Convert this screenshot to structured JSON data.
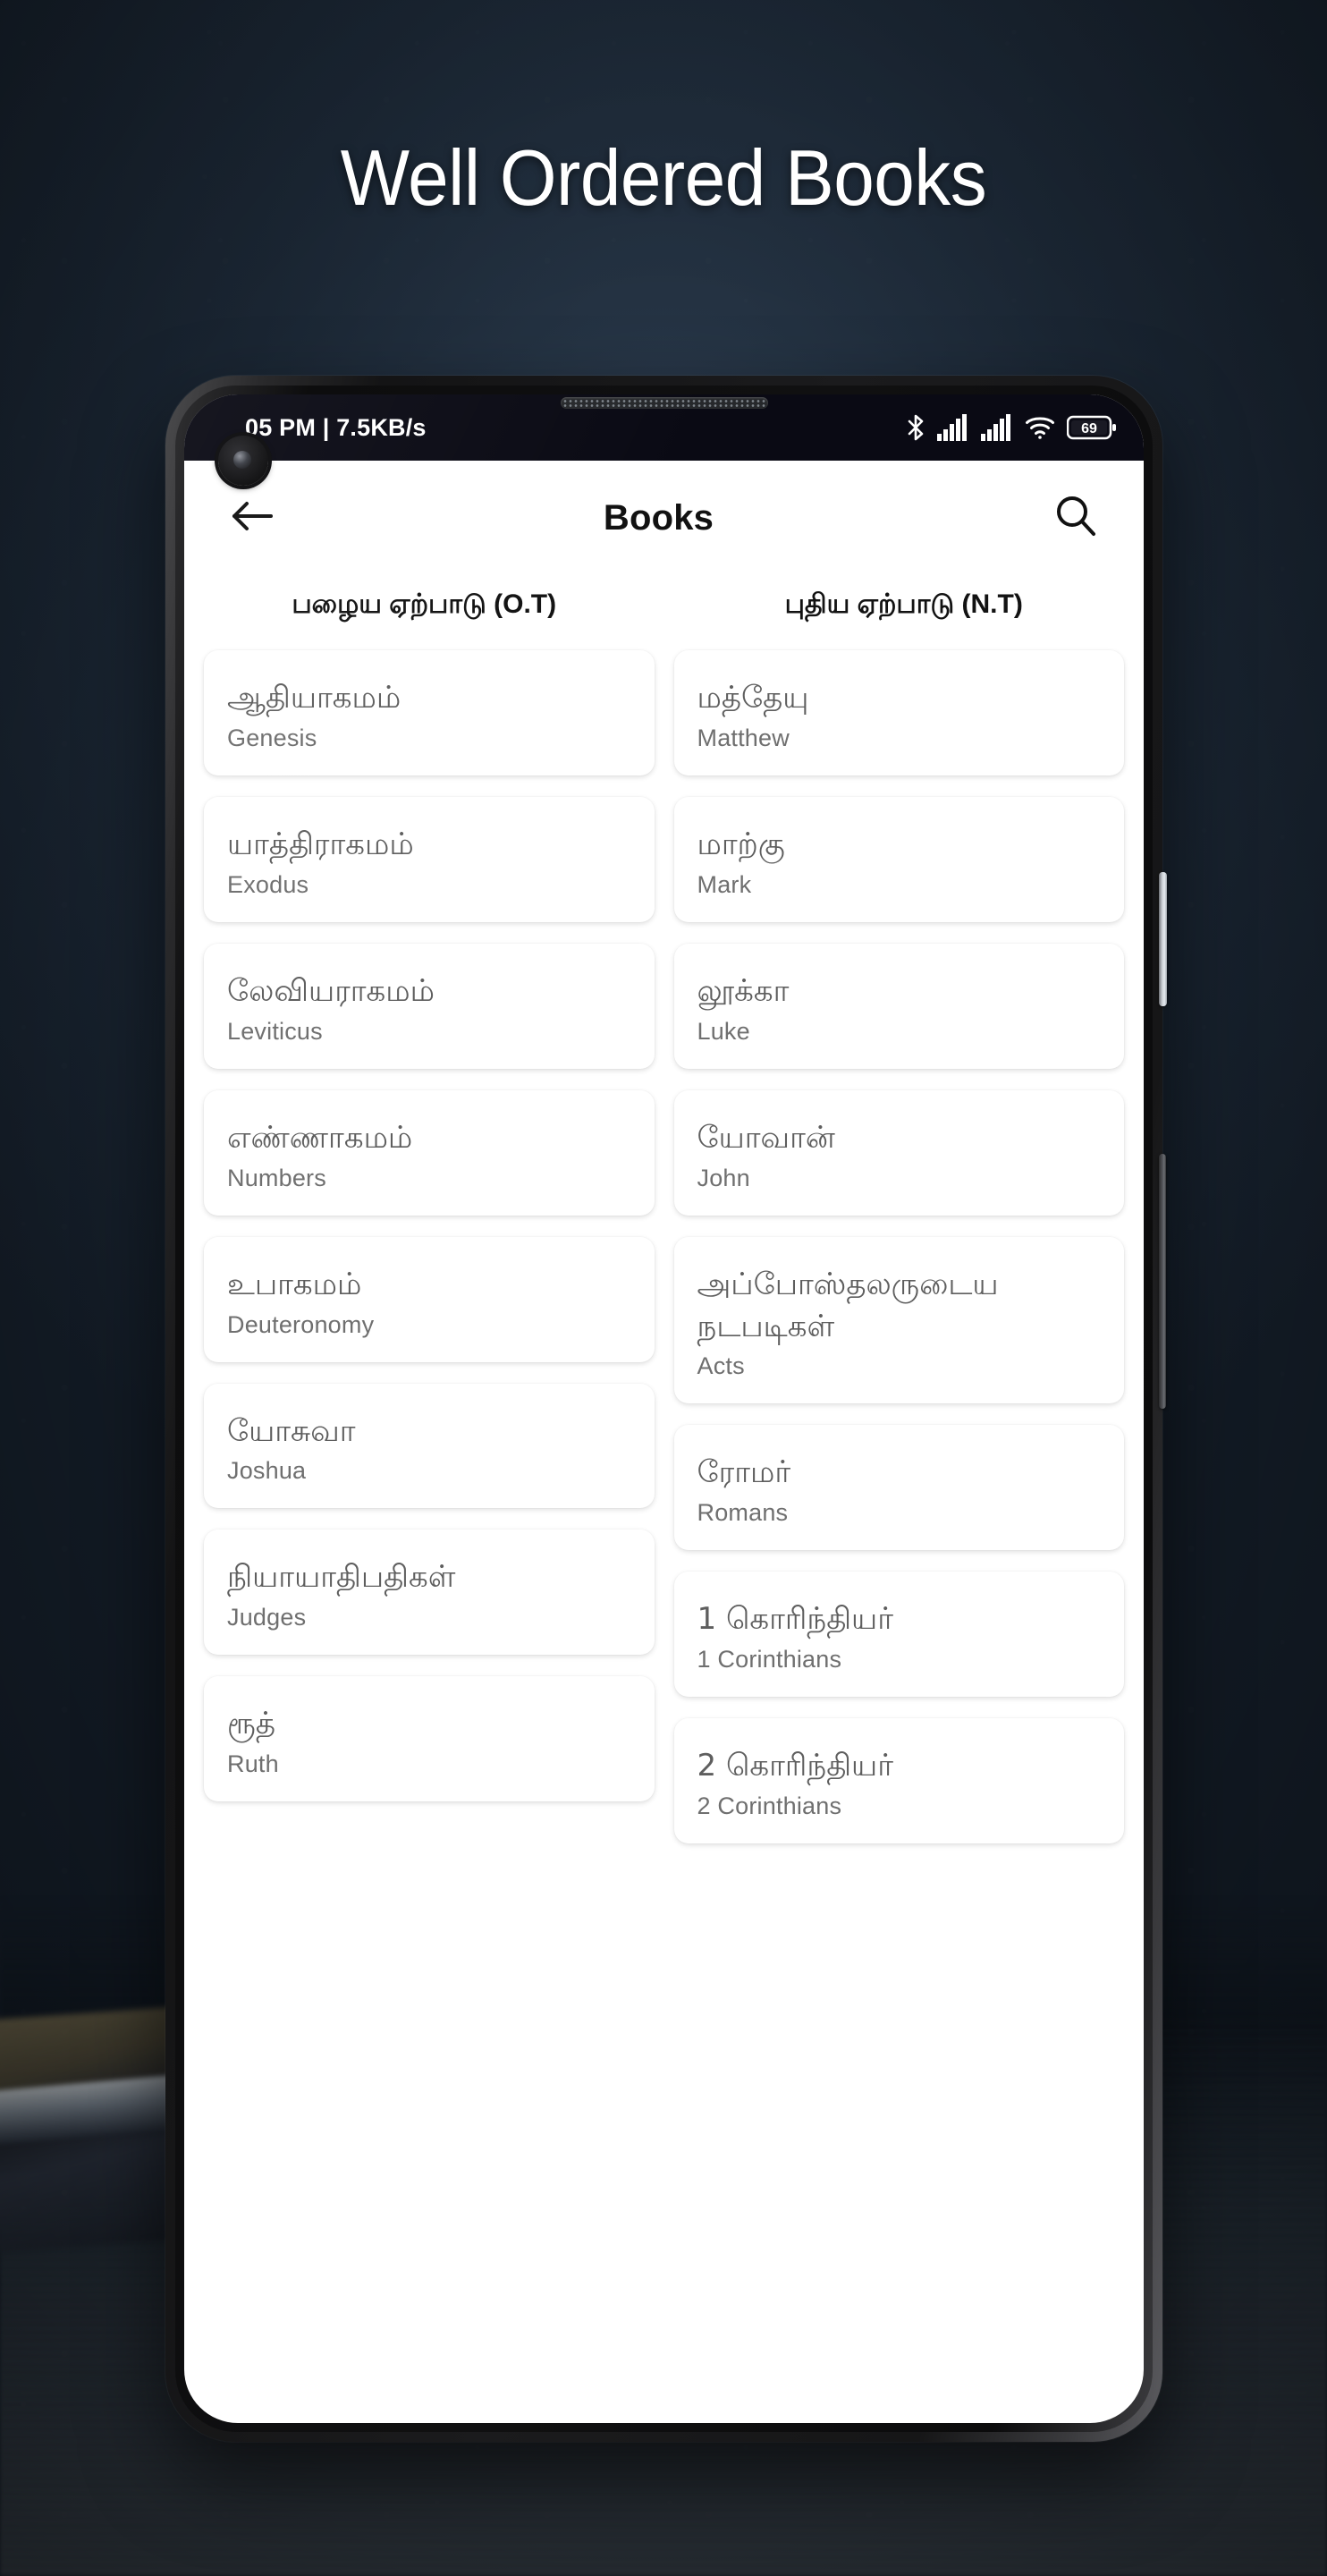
{
  "headline": "Well Ordered Books",
  "colors": {
    "background": "#1b2634",
    "headline_text": "#ffffff",
    "statusbar_bg": "#0a0a14",
    "card_bg": "#ffffff",
    "card_title_text": "#5e5e5e",
    "card_subtitle_text": "#6f6f6f",
    "appbar_text": "#111111"
  },
  "phone": {
    "status_bar": {
      "left_text": "05 PM | 7.5KB/s",
      "icons": [
        "bluetooth-icon",
        "signal-bars-sim1-icon",
        "signal-bars-sim2-icon",
        "wifi-icon",
        "battery-icon"
      ],
      "battery_level": "69"
    },
    "app_bar": {
      "back_label": "back-arrow-icon",
      "title": "Books",
      "search_label": "search-icon"
    },
    "tabs": [
      {
        "label": "பழைய ஏற்பாடு (O.T)",
        "selected": true
      },
      {
        "label": "புதிய ஏற்பாடு (N.T)",
        "selected": false
      }
    ],
    "old_testament": [
      {
        "tamil": "ஆதியாகமம்",
        "english": "Genesis"
      },
      {
        "tamil": "யாத்திராகமம்",
        "english": "Exodus"
      },
      {
        "tamil": "லேவியராகமம்",
        "english": "Leviticus"
      },
      {
        "tamil": "எண்ணாகமம்",
        "english": "Numbers"
      },
      {
        "tamil": "உபாகமம்",
        "english": "Deuteronomy"
      },
      {
        "tamil": "யோசுவா",
        "english": "Joshua"
      },
      {
        "tamil": "நியாயாதிபதிகள்",
        "english": "Judges"
      },
      {
        "tamil": "ரூத்",
        "english": "Ruth"
      }
    ],
    "new_testament": [
      {
        "tamil": "மத்தேயு",
        "english": "Matthew"
      },
      {
        "tamil": "மாற்கு",
        "english": "Mark"
      },
      {
        "tamil": "லூக்கா",
        "english": "Luke"
      },
      {
        "tamil": "யோவான்",
        "english": "John"
      },
      {
        "tamil": "அப்போஸ்தலருடைய நடபடிகள்",
        "english": "Acts"
      },
      {
        "tamil": "ரோமர்",
        "english": "Romans"
      },
      {
        "tamil": "1 கொரிந்தியர்",
        "english": "1 Corinthians"
      },
      {
        "tamil": "2 கொரிந்தியர்",
        "english": "2 Corinthians"
      }
    ]
  }
}
